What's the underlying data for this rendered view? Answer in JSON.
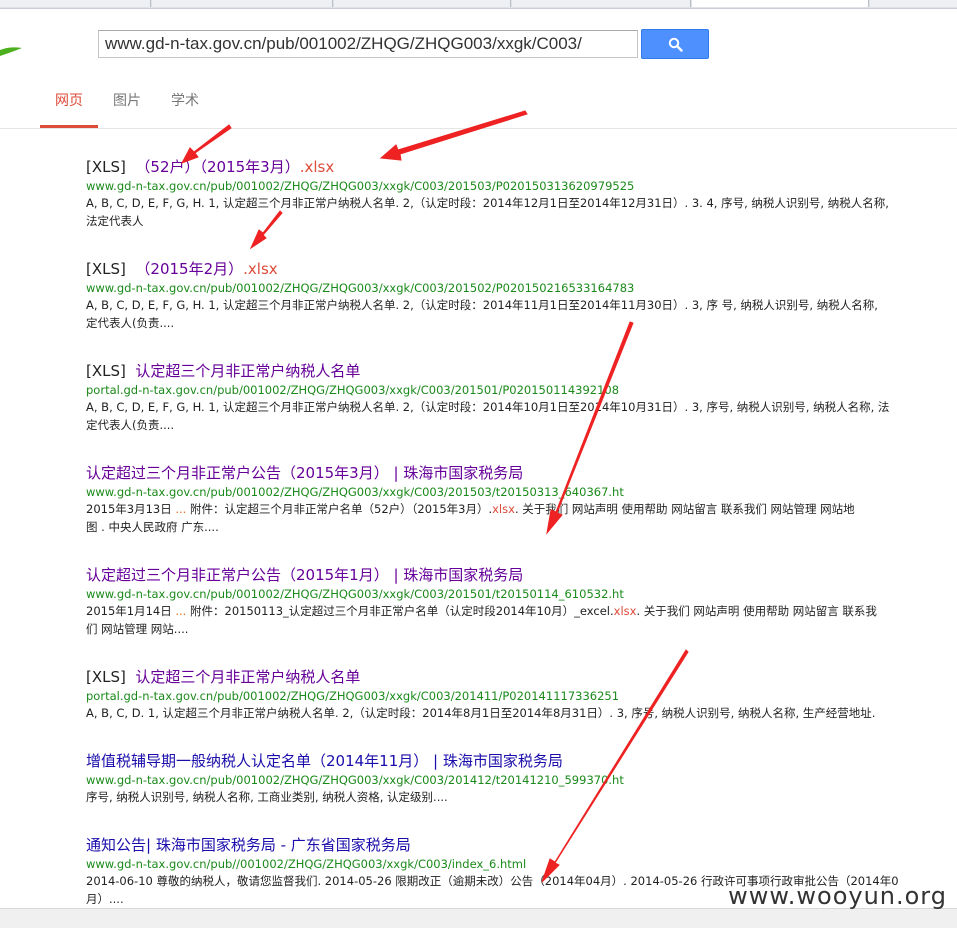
{
  "search": {
    "query": "www.gd-n-tax.gov.cn/pub/001002/ZHQG/ZHQG003/xxgk/C003/"
  },
  "nav": {
    "tabs": [
      "网页",
      "图片",
      "学术"
    ],
    "active_index": 0
  },
  "results": [
    {
      "tag": "[XLS]",
      "title": "（52户）（2015年3月）",
      "ext": ".xlsx",
      "url": "www.gd-n-tax.gov.cn/pub/001002/ZHQG/ZHQG003/xxgk/C003/201503/P020150313620979525",
      "snippet": [
        "A, B, C, D, E, F, G, H. 1, 认定超三个月非正常户纳税人名单. 2,（认定时段：2014年12月1日至2014年12月31日）. 3. 4, 序号, 纳税人识别号, 纳税人名称,",
        "法定代表人"
      ]
    },
    {
      "tag": "[XLS]",
      "title": "（2015年2月）",
      "ext": ".xlsx",
      "url": "www.gd-n-tax.gov.cn/pub/001002/ZHQG/ZHQG003/xxgk/C003/201502/P020150216533164783",
      "snippet": [
        "A, B, C, D, E, F, G, H. 1, 认定超三个月非正常户纳税人名单. 2,（认定时段：2014年11月1日至2014年11月30日）. 3, 序  号, 纳税人识别号, 纳税人名称,",
        "定代表人(负责...."
      ]
    },
    {
      "tag": "[XLS]",
      "title": "认定超三个月非正常户纳税人名单",
      "url": "portal.gd-n-tax.gov.cn/pub/001002/ZHQG/ZHQG003/xxgk/C003/201501/P020150114392108",
      "snippet": [
        "A, B, C, D, E, F, G, H. 1, 认定超三个月非正常户纳税人名单. 2,（认定时段：2014年10月1日至2014年10月31日）. 3, 序号, 纳税人识别号, 纳税人名称, 法",
        "定代表人(负责...."
      ]
    },
    {
      "title": "认定超过三个月非正常户公告（2015年3月） | 珠海市国家税务局",
      "url": "www.gd-n-tax.gov.cn/pub/001002/ZHQG/ZHQG003/xxgk/C003/201503/t20150313_640367.ht",
      "date": "2015年3月13日",
      "ellipsis": "...",
      "snippet_a": " 附件：认定超三个月非正常户名单（52户）（2015年3月）.",
      "snippet_hl": "xlsx",
      "snippet_b": ". 关于我们  网站声明  使用帮助  网站留言  联系我们  网站管理  网站地",
      "snippet2": "图 . 中央人民政府  广东...."
    },
    {
      "title": "认定超过三个月非正常户公告（2015年1月） | 珠海市国家税务局",
      "url": "www.gd-n-tax.gov.cn/pub/001002/ZHQG/ZHQG003/xxgk/C003/201501/t20150114_610532.ht",
      "date": "2015年1月14日",
      "ellipsis": "...",
      "snippet_a": " 附件：20150113_认定超过三个月非正常户名单（认定时段2014年10月）_excel.",
      "snippet_hl": "xlsx",
      "snippet_b": ". 关于我们  网站声明  使用帮助  网站留言  联系我",
      "snippet2": "们  网站管理  网站...."
    },
    {
      "tag": "[XLS]",
      "title": "认定超三个月非正常户纳税人名单",
      "url": "portal.gd-n-tax.gov.cn/pub/001002/ZHQG/ZHQG003/xxgk/C003/201411/P020141117336251",
      "snippet": [
        "A, B, C, D. 1, 认定超三个月非正常户纳税人名单. 2,（认定时段：2014年8月1日至2014年8月31日）. 3, 序号, 纳税人识别号, 纳税人名称, 生产经营地址."
      ]
    },
    {
      "title": "增值税辅导期一般纳税人认定名单（2014年11月） | 珠海市国家税务局",
      "url": "www.gd-n-tax.gov.cn/pub/001002/ZHQG/ZHQG003/xxgk/C003/201412/t20141210_599370.ht",
      "snippet": [
        "序号, 纳税人识别号, 纳税人名称, 工商业类别, 纳税人资格, 认定级别...."
      ]
    },
    {
      "title": "通知公告| 珠海市国家税务局 - 广东省国家税务局",
      "url": "www.gd-n-tax.gov.cn/pub//001002/ZHQG/ZHQG003/xxgk/C003/index_6.html",
      "snippet": [
        "2014-06-10 尊敬的纳税人，敬请您监督我们. 2014-05-26 限期改正（逾期未改）公告（2014年04月）. 2014-05-26 行政许可事项行政审批公告（2014年0",
        "月）...."
      ]
    }
  ],
  "watermark": "www.wooyun.org",
  "colors": {
    "accent": "#dd4b39",
    "visited": "#660099",
    "link": "#1a0dab",
    "url": "#1a8a1a",
    "button": "#4d90fe",
    "arrow": "#ee2222"
  }
}
